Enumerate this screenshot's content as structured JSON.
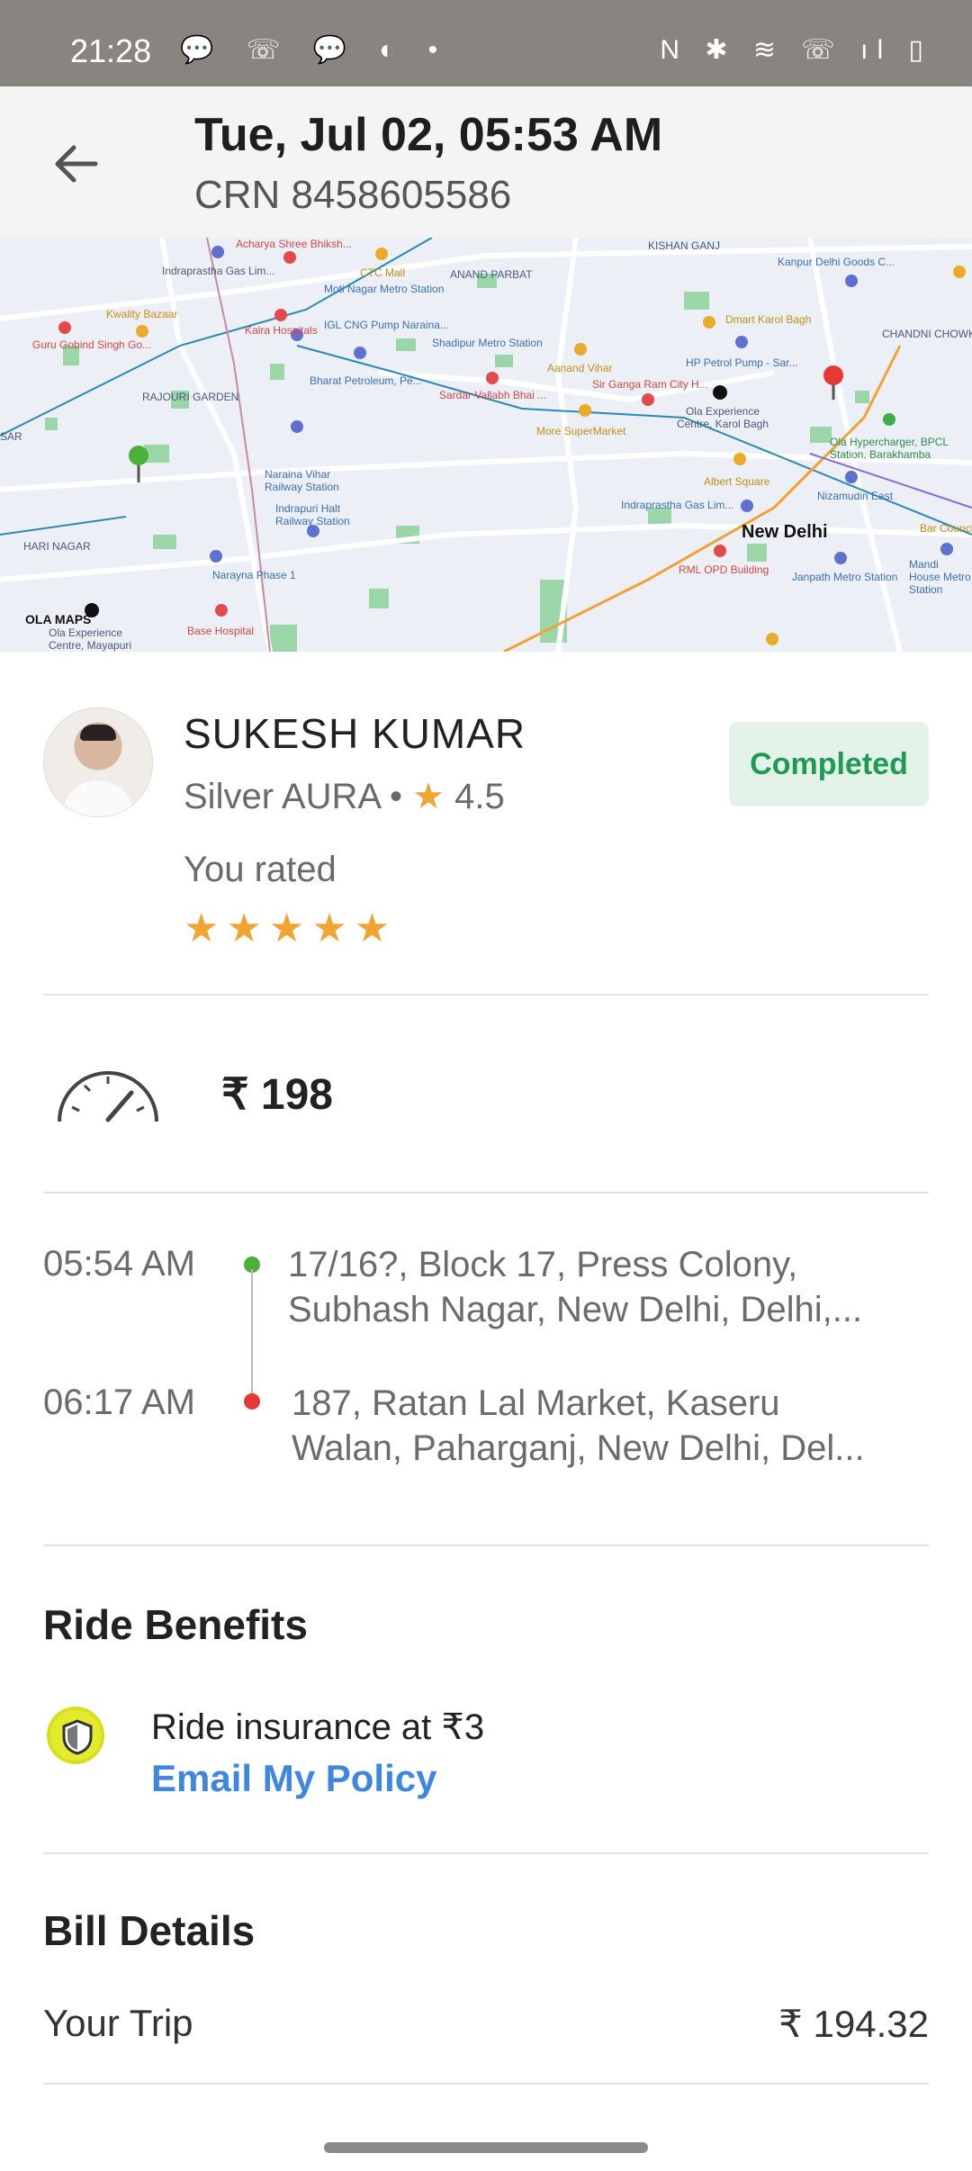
{
  "status_bar": {
    "time": "21:28",
    "left_icons": "💬 ☏ 💬 ◐ •",
    "right_icons": "N ✱ ≋ ☏ ıl ▯"
  },
  "header": {
    "title": "Tue, Jul 02, 05:53 AM",
    "crn": "CRN 8458605586"
  },
  "map": {
    "labels": [
      "Acharya Shree Bhiksh...",
      "CTC Mall",
      "ANAND PARBAT",
      "KISHAN GANJ",
      "Kanpur Delhi Goods C...",
      "Indraprastha Gas Lim...",
      "Moti Nagar Metro Station",
      "Kwality Bazaar",
      "Kalra Hospitals",
      "IGL CNG Pump Naraina...",
      "Shadipur Metro Station",
      "Dmart Karol Bagh",
      "CHANDNI CHOWK AREA",
      "Guru Gobind Singh Go...",
      "Bharat Petroleum, Pe...",
      "Aanand Vihar",
      "HP Petrol Pump - Sar...",
      "Sardar Vallabh Bhai ...",
      "Sir Ganga Ram City H...",
      "RAJOURI GARDEN",
      "Ola Experience Centre, Karol Bagh",
      "More SuperMarket",
      "Ola Hypercharger, BPCL Station, Barakhamba",
      "Naraina Vihar Railway Station",
      "Albert Square",
      "Nizamudin East",
      "Indrapuri Halt Railway Station",
      "Indraprastha Gas Lim...",
      "New Delhi",
      "Bar Council",
      "HARI NAGAR",
      "Narayna Phase 1",
      "RML OPD Building",
      "Janpath Metro Station",
      "Mandi House Metro Station",
      "OLA MAPS",
      "Base Hospital",
      "Ola Experience Centre, Mayapuri",
      "SAR"
    ]
  },
  "driver": {
    "name": "SUKESH  KUMAR",
    "vehicle": "Silver AURA • ",
    "rating": "4.5",
    "status": "Completed",
    "you_rated_label": "You rated",
    "stars_given": 5,
    "stars_text": "★★★★★"
  },
  "fare": {
    "amount": "₹ 198"
  },
  "trip": {
    "pickup_time": "05:54 AM",
    "pickup_address": "17/16?, Block 17, Press Colony, Subhash Nagar, New Delhi, Delhi,...",
    "drop_time": "06:17 AM",
    "drop_address": "187, Ratan Lal Market, Kaseru Walan, Paharganj, New Delhi, Del...",
    "pickup_color": "#4caf3a",
    "drop_color": "#e53935"
  },
  "benefits": {
    "title": "Ride Benefits",
    "insurance_text": "Ride insurance at ₹3",
    "email_link": "Email My Policy"
  },
  "bill": {
    "title": "Bill Details",
    "your_trip_label": "Your Trip",
    "your_trip_value": "₹ 194.32"
  },
  "colors": {
    "accent_link": "#3e86e0",
    "status_green": "#1f9a52",
    "star": "#f0a533"
  }
}
